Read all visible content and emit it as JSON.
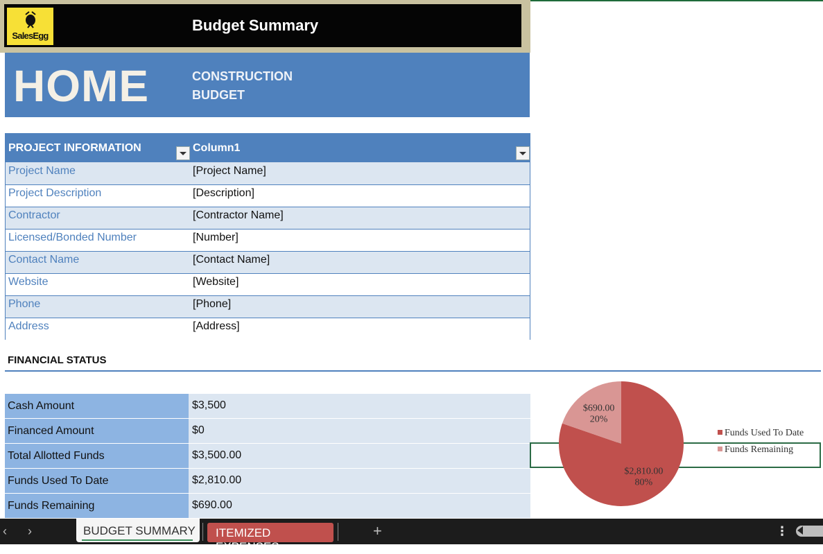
{
  "header": {
    "logo_text": "SalesEgg",
    "title": "Budget Summary"
  },
  "banner": {
    "big": "HOME",
    "line1": "CONSTRUCTION",
    "line2": "BUDGET"
  },
  "project_table": {
    "headers": [
      "PROJECT INFORMATION",
      "Column1"
    ],
    "rows": [
      {
        "label": "Project Name",
        "value": "[Project Name]"
      },
      {
        "label": "Project Description",
        "value": "[Description]"
      },
      {
        "label": "Contractor",
        "value": "[Contractor Name]"
      },
      {
        "label": "Licensed/Bonded Number",
        "value": "[Number]"
      },
      {
        "label": "Contact Name",
        "value": "[Contact Name]"
      },
      {
        "label": "Website",
        "value": "[Website]"
      },
      {
        "label": "Phone",
        "value": "[Phone]"
      },
      {
        "label": "Address",
        "value": "[Address]"
      }
    ]
  },
  "financial": {
    "title": "FINANCIAL STATUS",
    "rows": [
      {
        "label": "Cash Amount",
        "value": "$3,500"
      },
      {
        "label": "Financed Amount",
        "value": "$0"
      },
      {
        "label": "Total Allotted Funds",
        "value": "$3,500.00"
      },
      {
        "label": "Funds Used To Date",
        "value": "$2,810.00"
      },
      {
        "label": "Funds Remaining",
        "value": "$690.00"
      }
    ]
  },
  "chart_data": {
    "type": "pie",
    "categories": [
      "Funds Used To Date",
      "Funds Remaining"
    ],
    "values": [
      2810,
      690
    ],
    "data_labels": [
      {
        "amount": "$2,810.00",
        "percent": "80%"
      },
      {
        "amount": "$690.00",
        "percent": "20%"
      }
    ],
    "colors": [
      "#c0504d",
      "#d99694"
    ],
    "legend_position": "right"
  },
  "tabs": {
    "active": "BUDGET SUMMARY",
    "other": "ITEMIZED EXPENSES",
    "nav_prev": "‹",
    "nav_next": "›",
    "add": "+",
    "more": "⋮"
  },
  "colors": {
    "accent_blue": "#4f81bd",
    "light_blue": "#dce6f1",
    "mid_blue": "#8db4e2",
    "tab_red": "#c0504d",
    "logo_yellow": "#f7e036"
  }
}
